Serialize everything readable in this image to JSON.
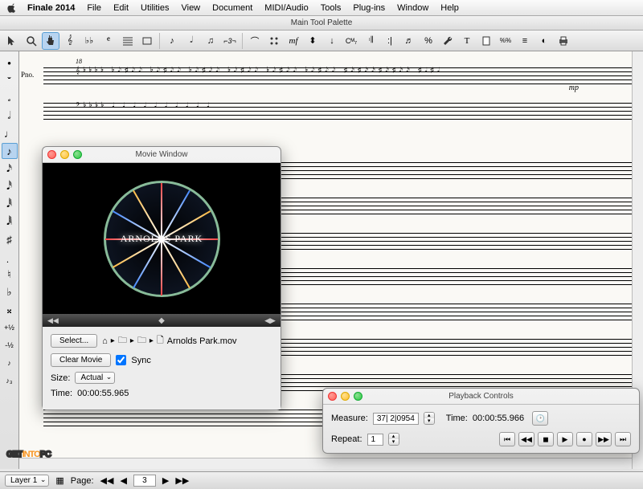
{
  "menubar": {
    "app_name": "Finale 2014",
    "items": [
      "File",
      "Edit",
      "Utilities",
      "View",
      "Document",
      "MIDI/Audio",
      "Tools",
      "Plug-ins",
      "Window",
      "Help"
    ]
  },
  "document": {
    "title": "Main Tool Palette"
  },
  "toolbar_icons": [
    "pointer",
    "zoom",
    "hand",
    "clef",
    "key-sig",
    "time-sig",
    "staff",
    "measure",
    "note-entry",
    "speedy",
    "hyperscribe",
    "tuplet",
    "smartshape",
    "articulation",
    "expression",
    "dynamic",
    "lyric",
    "chord",
    "repeat",
    "ending",
    "graphic",
    "percent",
    "tool",
    "text",
    "page",
    "mm",
    "tempo",
    "mirror",
    "print"
  ],
  "left_palette": [
    "dot",
    "half-rest",
    "whole-note",
    "semibreve",
    "quarter",
    "eighth",
    "repeat-out",
    "sixteenth",
    "thirtysecond",
    "sixtyfourth",
    "sharp",
    "flag",
    "natural",
    "flat",
    "flag2",
    "plus-half",
    "minus-half",
    "grace",
    "triplet"
  ],
  "left_palette_selected_index": 5,
  "score": {
    "instrument_label": "Pno.",
    "measure_number": "18",
    "dynamic_mark": "mp"
  },
  "movie_window": {
    "title": "Movie Window",
    "overlay_text": "ARNOLDS PARK",
    "select_button": "Select...",
    "clear_button": "Clear Movie",
    "sync_label": "Sync",
    "sync_checked": true,
    "size_label": "Size:",
    "size_value": "Actual",
    "time_label": "Time:",
    "time_value": "00:00:55.965",
    "breadcrumb_file": "Arnolds Park.mov"
  },
  "playback": {
    "title": "Playback Controls",
    "measure_label": "Measure:",
    "measure_value": "37| 2|0954",
    "time_label": "Time:",
    "time_value": "00:00:55.966",
    "repeat_label": "Repeat:",
    "repeat_value": "1"
  },
  "bottom_bar": {
    "layer_label": "Layer 1",
    "page_label": "Page:",
    "page_value": "3"
  },
  "watermark": {
    "pre": "GET",
    "mid": "INTO",
    "post": "PC"
  }
}
